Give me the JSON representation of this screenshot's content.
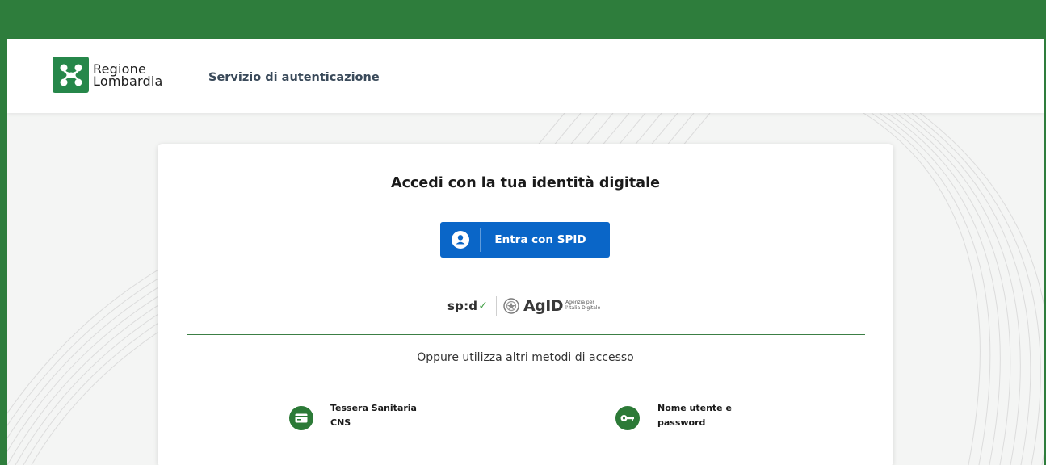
{
  "header": {
    "logo_line1": "Regione",
    "logo_line2": "Lombardia",
    "service_title": "Servizio di autenticazione"
  },
  "card": {
    "title": "Accedi con la tua identità digitale",
    "spid_button_label": "Entra con SPID",
    "spid_brand": "sp:d",
    "agid_brand": "AgID",
    "agid_sub_line1": "Agenzia per",
    "agid_sub_line2": "l'Italia Digitale",
    "alt_methods_text": "Oppure utilizza altri metodi di accesso",
    "methods": [
      {
        "line1": "Tessera Sanitaria",
        "line2": "CNS",
        "icon": "card-icon"
      },
      {
        "line1": "Nome utente e",
        "line2": "password",
        "icon": "key-icon"
      }
    ]
  },
  "colors": {
    "brand_green": "#2e7d3c",
    "spid_blue": "#0a66c8",
    "method_icon_green": "#2c7a37"
  }
}
